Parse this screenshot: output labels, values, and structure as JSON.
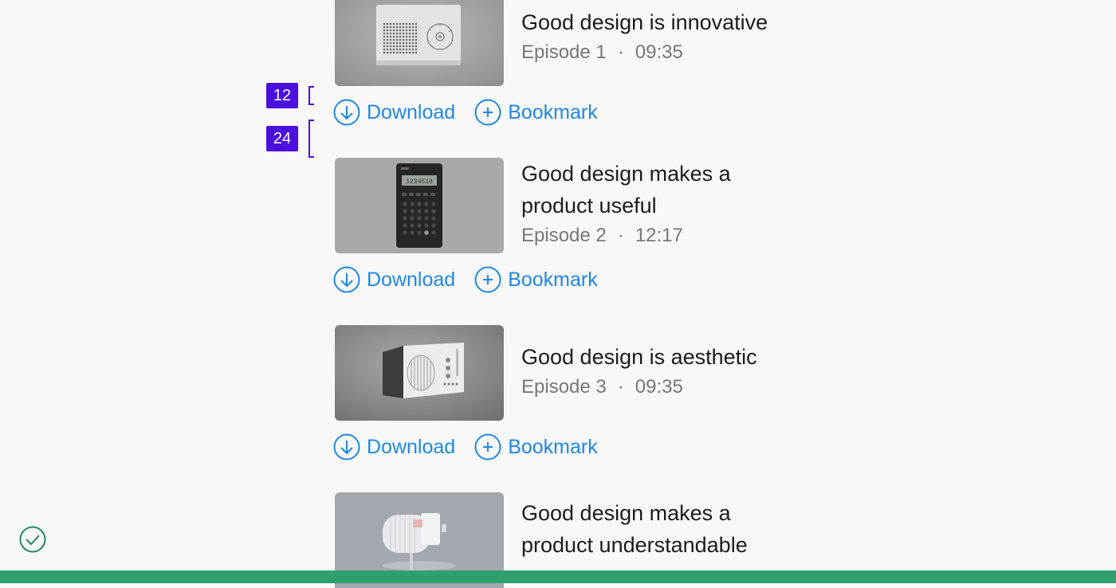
{
  "colors": {
    "accent": "#1e88e5",
    "annotation": "#4b0fe0",
    "success": "#2ea06f",
    "check": "#1f8a5a",
    "meta_text": "#777777"
  },
  "annotations": [
    {
      "label": "12"
    },
    {
      "label": "24"
    }
  ],
  "episodes": [
    {
      "title": "Good design is innovative",
      "episode": "Episode 1",
      "separator": "·",
      "duration": "09:35",
      "download_label": "Download",
      "bookmark_label": "Bookmark",
      "thumbnail_icon": "radio-thumbnail"
    },
    {
      "title": "Good design makes a product useful",
      "episode": "Episode 2",
      "separator": "·",
      "duration": "12:17",
      "download_label": "Download",
      "bookmark_label": "Bookmark",
      "thumbnail_icon": "calculator-thumbnail"
    },
    {
      "title": "Good design is aesthetic",
      "episode": "Episode 3",
      "separator": "·",
      "duration": "09:35",
      "download_label": "Download",
      "bookmark_label": "Bookmark",
      "thumbnail_icon": "speaker-radio-thumbnail"
    },
    {
      "title": "Good design makes a product understandable",
      "thumbnail_icon": "thermostat-thumbnail"
    }
  ],
  "status": {
    "icon": "check-circle-icon"
  }
}
